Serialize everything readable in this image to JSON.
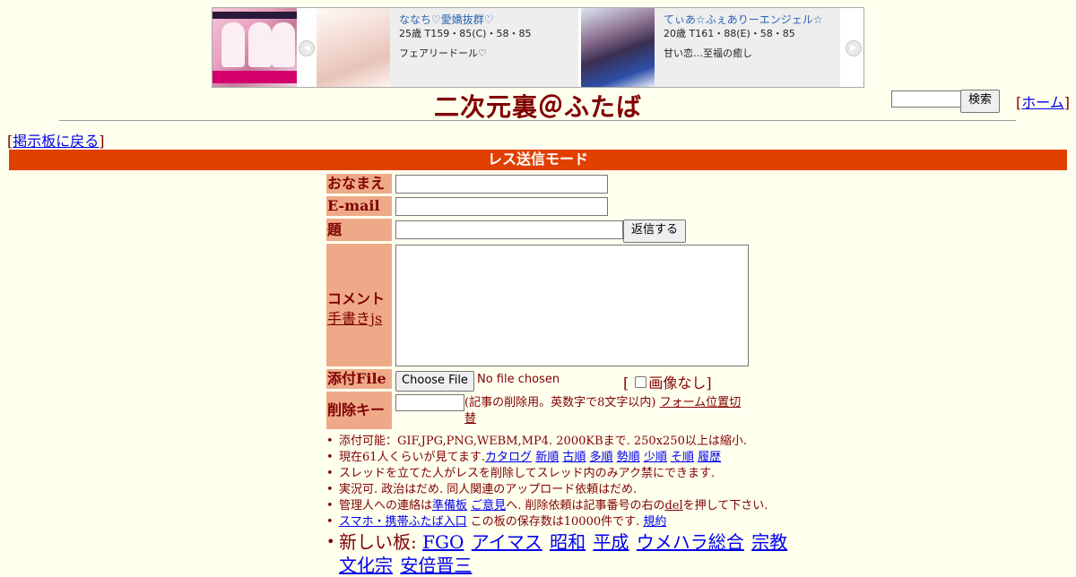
{
  "ad": {
    "prev_arrow": "◀",
    "next_arrow": "▶",
    "cards": [
      {
        "name": "ななち♡愛嬌抜群♡",
        "stats": "25歳 T159・85(C)・58・85",
        "desc": "フェアリードール♡"
      },
      {
        "name": "てぃあ☆ふぇありーエンジェル☆",
        "stats": "20歳 T161・88(E)・58・85",
        "desc": "甘い恋…至福の癒し"
      }
    ]
  },
  "search": {
    "placeholder": "",
    "button_label": "検索"
  },
  "home_link": {
    "label": "ホーム"
  },
  "page_title": "二次元裏＠ふたば",
  "back_link": {
    "label": "掲示板に戻る"
  },
  "mode_bar": "レス送信モード",
  "form": {
    "name_label": "おなまえ",
    "email_label": "E-mail",
    "subject_label": "題　名",
    "submit_label": "返信する",
    "comment_label": "コメント",
    "handwriting_link": "手書きjs",
    "file_label": "添付File",
    "file_button": "Choose File",
    "file_status": "No file chosen",
    "no_image_prefix": "[",
    "no_image_label": "画像なし",
    "no_image_suffix": "]",
    "delkey_label": "削除キー",
    "delkey_note": "(記事の削除用。英数字で8文字以内)",
    "form_position_link": "フォーム位置切替"
  },
  "notices": {
    "line1": "添付可能：GIF,JPG,PNG,WEBM,MP4. 2000KBまで. 250x250以上は縮小.",
    "line2_prefix": "現在61人くらいが見てます.",
    "line2_links": [
      "カタログ",
      "新順",
      "古順",
      "多順",
      "勢順",
      "少順",
      "そ順",
      "履歴"
    ],
    "line3": "スレッドを立てた人がレスを削除してスレッド内のみアク禁にできます.",
    "line4": "実況可. 政治はだめ. 同人関連のアップロード依頼はだめ.",
    "line5_prefix": "管理人への連絡は",
    "line5_link1": "準備板",
    "line5_mid": "ご意見",
    "line5_suffix": "へ. 削除依頼は記事番号の右の",
    "line5_del": "del",
    "line5_end": "を押して下さい.",
    "line6_link": "スマホ・携帯ふたば入口",
    "line6_mid": " この板の保存数は10000件です.",
    "line6_rules": "規約"
  },
  "new_boards": {
    "prefix": "新しい板:",
    "links": [
      "FGO",
      "アイマス",
      "昭和",
      "平成",
      "ウメハラ総合",
      "宗教",
      "文化宗",
      "安倍晋三"
    ]
  }
}
